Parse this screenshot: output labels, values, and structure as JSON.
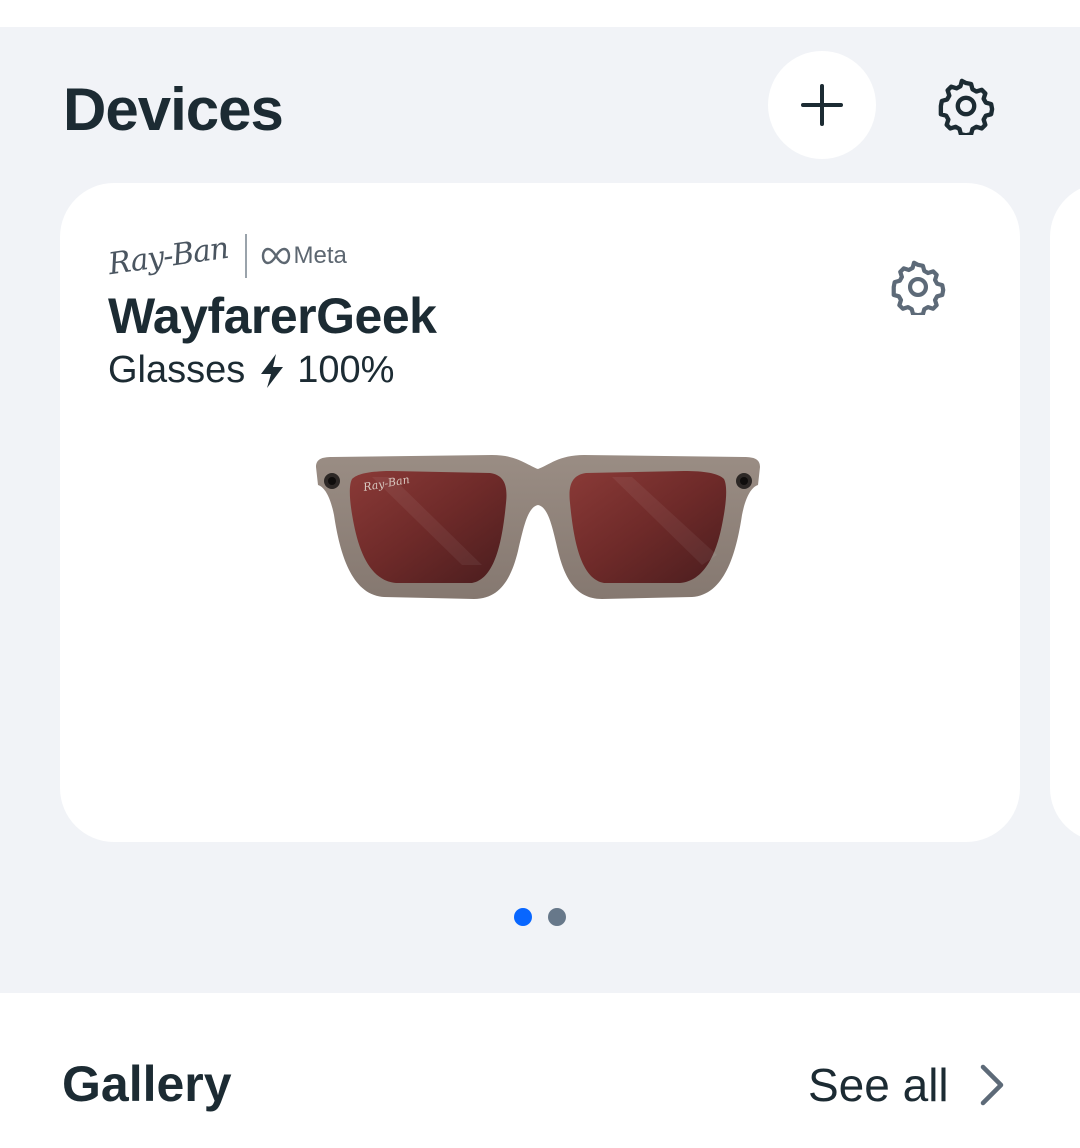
{
  "header": {
    "title": "Devices",
    "add_icon": "plus-icon",
    "settings_icon": "gear-icon"
  },
  "device": {
    "brand_rayban": "Ray-Ban",
    "brand_meta": "Meta",
    "name": "WayfarerGeek",
    "type": "Glasses",
    "battery_icon": "lightning-bolt-icon",
    "battery": "100%",
    "settings_icon": "gear-icon",
    "image": "ray-ban-meta-wayfarer-glasses"
  },
  "pager": {
    "count": 2,
    "active_index": 0,
    "active_color": "#0866ff",
    "inactive_color": "#67788a"
  },
  "gallery": {
    "title": "Gallery",
    "see_all": "See all",
    "chevron_icon": "chevron-right-icon"
  },
  "colors": {
    "background": "#f1f3f7",
    "card": "#ffffff",
    "text": "#1c2b33",
    "icon": "#5d6a78"
  }
}
